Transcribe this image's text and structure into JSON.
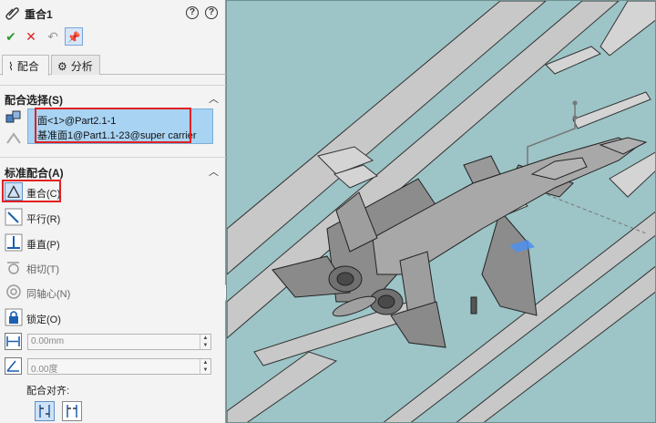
{
  "panel": {
    "title": "重合1",
    "help_1": "?",
    "help_2": "?",
    "tabs": [
      {
        "label": "配合"
      },
      {
        "label": "分析"
      }
    ],
    "mate_selection": {
      "header": "配合选择(S)",
      "items": [
        "面<1>@Part2.1-1",
        "基准面1@Part1.1-23@super carrier"
      ]
    },
    "standard_mates": {
      "header": "标准配合(A)",
      "items": [
        {
          "label": "重合(C)",
          "selected": true
        },
        {
          "label": "平行(R)"
        },
        {
          "label": "垂直(P)"
        },
        {
          "label": "相切(T)"
        },
        {
          "label": "同轴心(N)"
        },
        {
          "label": "锁定(O)"
        }
      ],
      "distance_value": "0.00mm",
      "angle_value": "0.00度",
      "alignment_label": "配合对齐:"
    }
  },
  "colors": {
    "viewport_bg": "#9dc4c6",
    "selection_bg": "#a8d3f3",
    "highlight_red": "#e32020"
  }
}
